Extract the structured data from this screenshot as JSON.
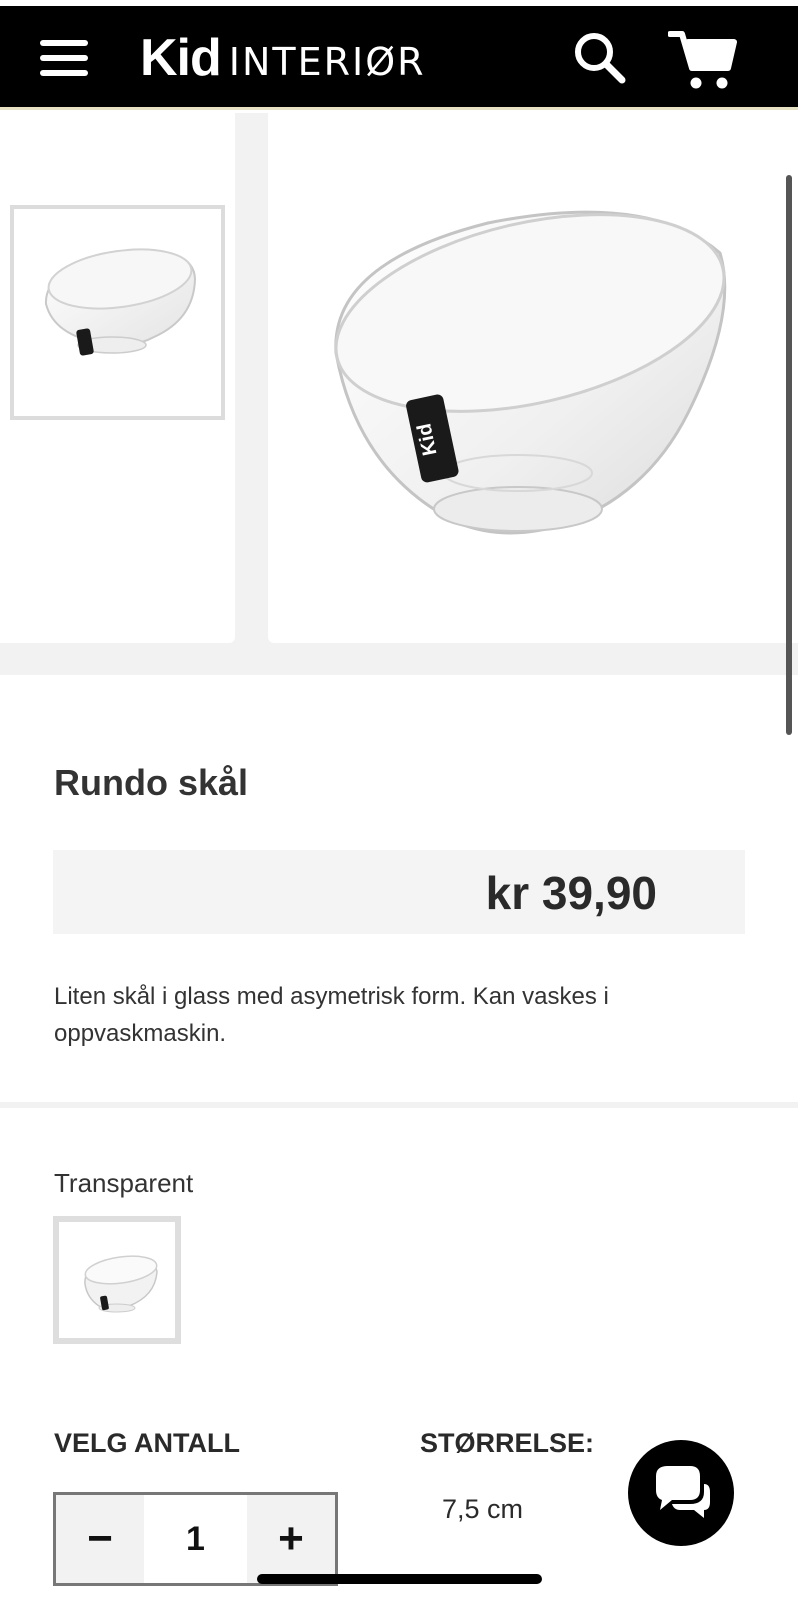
{
  "header": {
    "logo_brand": "Kid",
    "logo_suffix": "INTERIØR",
    "menu_icon": "hamburger-menu-icon",
    "search_icon": "search-icon",
    "cart_icon": "cart-icon"
  },
  "gallery": {
    "thumbnail_badge": "Kid",
    "main_badge": "Kid"
  },
  "product": {
    "title": "Rundo skål",
    "price": "kr 39,90",
    "description": "Liten skål i glass med asymetrisk form. Kan vaskes i oppvaskmaskin."
  },
  "variant": {
    "label": "Transparent"
  },
  "options": {
    "quantity_label": "VELG ANTALL",
    "quantity_value": "1",
    "minus_label": "−",
    "plus_label": "+",
    "size_label": "STØRRELSE:",
    "size_value": "7,5 cm"
  },
  "chat": {
    "icon": "chat-bubbles-icon"
  },
  "colors": {
    "header_bg": "#000000",
    "price_bg": "#f4f4f4",
    "gallery_bg": "#f2f2f2"
  }
}
